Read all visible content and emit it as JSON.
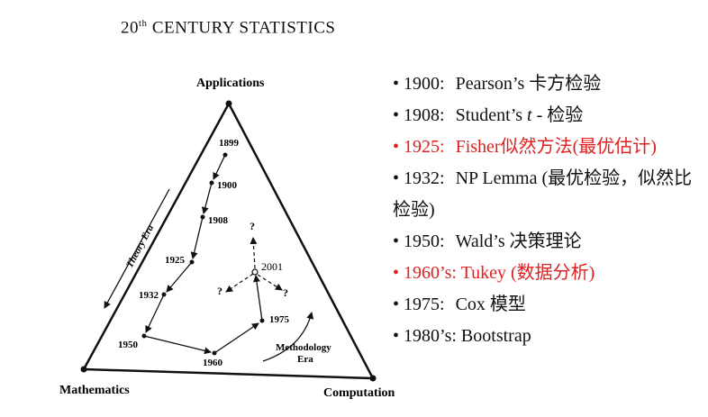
{
  "header": {
    "prefix": "20",
    "sup": "th",
    "rest": " CENTURY STATISTICS"
  },
  "diagram": {
    "vertices": {
      "top": "Applications",
      "left": "Mathematics",
      "right": "Computation"
    },
    "years": {
      "y1899": "1899",
      "y1900": "1900",
      "y1908": "1908",
      "y1925": "1925",
      "y1932": "1932",
      "y1950": "1950",
      "y1960": "1960",
      "y1975": "1975",
      "y2001": "2001"
    },
    "question_mark": "?",
    "theory_era": "Theory Era",
    "methodology_era_line1": "Methodology",
    "methodology_era_line2": "Era"
  },
  "bullets": [
    {
      "year": "1900:",
      "pre": "Pearson’s 卡方检验",
      "italic": "",
      "post": "",
      "color": "#111111"
    },
    {
      "year": "1908:",
      "pre": "Student’s ",
      "italic": "t",
      "post": " - 检验",
      "color": "#111111"
    },
    {
      "year": "1925:",
      "pre": "Fisher似然方法(最优估计)",
      "italic": "",
      "post": "",
      "color": "#e02020"
    },
    {
      "year": "1932:",
      "pre": "NP Lemma (最优检验，似然比检验)",
      "italic": "",
      "post": "",
      "color": "#111111"
    },
    {
      "year": "1950:",
      "pre": "Wald’s 决策理论",
      "italic": "",
      "post": "",
      "color": "#111111"
    },
    {
      "year": "1960’s:",
      "pre": "Tukey (数据分析)",
      "italic": "",
      "post": "",
      "color": "#e02020"
    },
    {
      "year": "1975:",
      "pre": "Cox 模型",
      "italic": "",
      "post": "",
      "color": "#111111"
    },
    {
      "year": "1980’s:",
      "pre": "Bootstrap",
      "italic": "",
      "post": "",
      "color": "#111111"
    }
  ]
}
